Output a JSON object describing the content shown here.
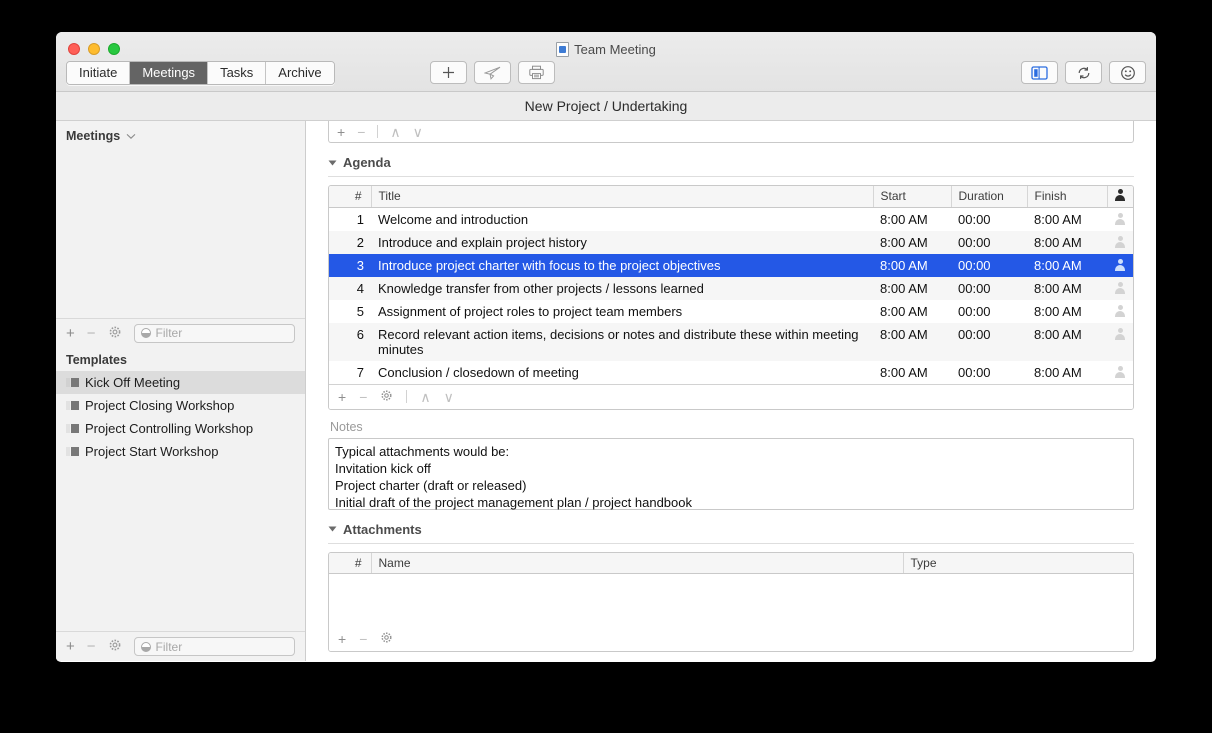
{
  "window": {
    "document_title": "Team Meeting",
    "subtitle": "New Project / Undertaking",
    "doc_icon": "document-icon"
  },
  "tabs": [
    {
      "label": "Initiate",
      "active": false
    },
    {
      "label": "Meetings",
      "active": true
    },
    {
      "label": "Tasks",
      "active": false
    },
    {
      "label": "Archive",
      "active": false
    }
  ],
  "toolbar": {
    "center": [
      {
        "name": "add-button",
        "icon": "plus-icon"
      },
      {
        "name": "send-button",
        "icon": "paper-plane-icon"
      },
      {
        "name": "print-button",
        "icon": "printer-icon"
      }
    ],
    "right": [
      {
        "name": "sidebar-toggle-button",
        "icon": "sidebar-icon",
        "active": true
      },
      {
        "name": "sync-button",
        "icon": "refresh-icon",
        "active": false
      },
      {
        "name": "emoji-button",
        "icon": "smiley-icon",
        "active": false
      }
    ],
    "accent_color": "#2458e6"
  },
  "sidebar": {
    "header": "Meetings",
    "header_chevron": "chevron-down-icon",
    "meetings_items": [],
    "meetings_toolbar": {
      "add": "+",
      "remove": "−",
      "settings": "gear-icon",
      "filter_placeholder": "Filter"
    },
    "templates_label": "Templates",
    "templates": [
      {
        "label": "Kick Off Meeting",
        "selected": true
      },
      {
        "label": "Project Closing Workshop",
        "selected": false
      },
      {
        "label": "Project Controlling Workshop",
        "selected": false
      },
      {
        "label": "Project Start Workshop",
        "selected": false
      }
    ],
    "templates_toolbar": {
      "add": "+",
      "remove": "−",
      "settings": "gear-icon",
      "filter_placeholder": "Filter"
    }
  },
  "main": {
    "cut_toolbar": {
      "add": "+",
      "remove": "−",
      "up": "∧",
      "down": "∨"
    },
    "agenda": {
      "title": "Agenda",
      "columns": [
        "#",
        "Title",
        "Start",
        "Duration",
        "Finish",
        "person-icon"
      ],
      "rows": [
        {
          "num": "1",
          "title": "Welcome and introduction",
          "start": "8:00 AM",
          "duration": "00:00",
          "finish": "8:00 AM",
          "selected": false
        },
        {
          "num": "2",
          "title": "Introduce and explain project history",
          "start": "8:00 AM",
          "duration": "00:00",
          "finish": "8:00 AM",
          "selected": false
        },
        {
          "num": "3",
          "title": "Introduce project charter with focus to the project objectives",
          "start": "8:00 AM",
          "duration": "00:00",
          "finish": "8:00 AM",
          "selected": true
        },
        {
          "num": "4",
          "title": "Knowledge transfer from other projects / lessons learned",
          "start": "8:00 AM",
          "duration": "00:00",
          "finish": "8:00 AM",
          "selected": false
        },
        {
          "num": "5",
          "title": "Assignment of project roles to project team members",
          "start": "8:00 AM",
          "duration": "00:00",
          "finish": "8:00 AM",
          "selected": false
        },
        {
          "num": "6",
          "title": "Record relevant action items, decisions or notes and distribute these within meeting minutes",
          "start": "8:00 AM",
          "duration": "00:00",
          "finish": "8:00 AM",
          "selected": false
        },
        {
          "num": "7",
          "title": "Conclusion / closedown of meeting",
          "start": "8:00 AM",
          "duration": "00:00",
          "finish": "8:00 AM",
          "selected": false
        }
      ],
      "toolbar": {
        "add": "+",
        "remove": "−",
        "settings": "gear-icon",
        "up": "∧",
        "down": "∨"
      }
    },
    "notes": {
      "label": "Notes",
      "lines": [
        "Typical attachments would be:",
        "Invitation kick off",
        "Project charter (draft or released)",
        "Initial draft of the project management plan / project handbook"
      ]
    },
    "attachments": {
      "title": "Attachments",
      "columns": [
        "#",
        "Name",
        "Type"
      ],
      "rows": [],
      "toolbar": {
        "add": "+",
        "remove": "−",
        "settings": "gear-icon"
      }
    }
  }
}
